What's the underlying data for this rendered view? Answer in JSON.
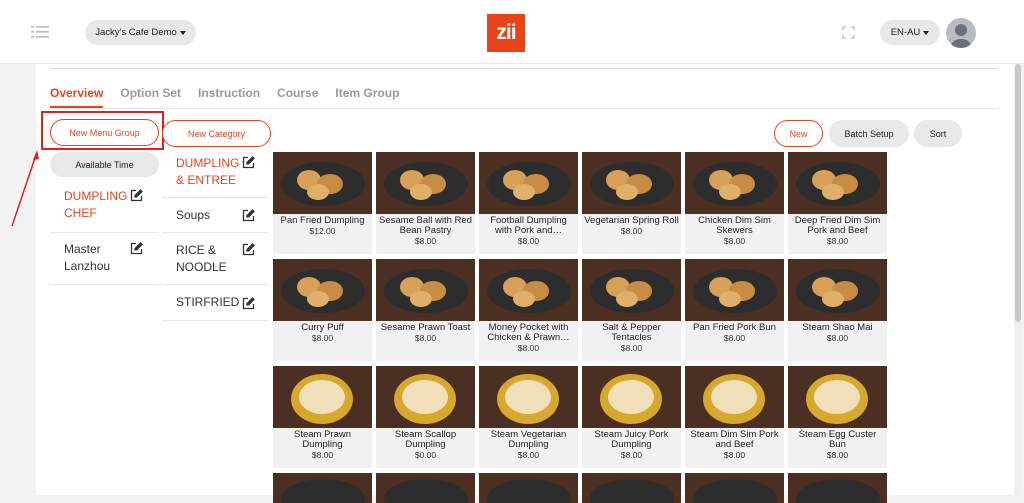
{
  "header": {
    "shop_name": "Jacky's Cafe Demo",
    "logo_text": "zii",
    "language": "EN-AU",
    "brand_color": "#e8441c"
  },
  "tabs": [
    {
      "label": "Overview",
      "active": true
    },
    {
      "label": "Option Set"
    },
    {
      "label": "Instruction"
    },
    {
      "label": "Course"
    },
    {
      "label": "Item Group"
    }
  ],
  "buttons": {
    "new_menu_group": "New Menu Group",
    "new_category": "New Category",
    "available_time": "Available Time",
    "new": "New",
    "batch_setup": "Batch Setup",
    "sort": "Sort"
  },
  "menu_groups": [
    {
      "label": "DUMPLING CHEF",
      "active": true
    },
    {
      "label": "Master Lanzhou"
    }
  ],
  "categories": [
    {
      "label": "DUMPLING & ENTREE",
      "active": true
    },
    {
      "label": "Soups"
    },
    {
      "label": "RICE & NOODLE"
    },
    {
      "label": "STIRFRIED"
    }
  ],
  "items": [
    {
      "name": "Pan Fried Dumpling",
      "price": "$12.00"
    },
    {
      "name": "Sesame Ball with Red Bean Pastry",
      "price": "$8.00"
    },
    {
      "name": "Football Dumpling with Pork and…",
      "price": "$8.00"
    },
    {
      "name": "Vegetarian Spring Roll",
      "price": "$8.00"
    },
    {
      "name": "Chicken Dim Sim Skewers",
      "price": "$8.00"
    },
    {
      "name": "Deep Fried Dim Sim Pork and Beef",
      "price": "$8.00"
    },
    {
      "name": "Curry Puff",
      "price": "$8.00"
    },
    {
      "name": "Sesame Prawn Toast",
      "price": "$8.00"
    },
    {
      "name": "Money Pocket with Chicken & Prawn…",
      "price": "$8.00"
    },
    {
      "name": "Salt & Pepper Tentacles",
      "price": "$8.00"
    },
    {
      "name": "Pan Fried Pork Bun",
      "price": "$8.00"
    },
    {
      "name": "Steam Shao Mai",
      "price": "$8.00"
    },
    {
      "name": "Steam Prawn Dumpling",
      "price": "$8.00"
    },
    {
      "name": "Steam Scallop Dumpling",
      "price": "$0.00"
    },
    {
      "name": "Steam Vegetarian Dumpling",
      "price": "$8.00"
    },
    {
      "name": "Steam Juicy Pork Dumpling",
      "price": "$8.00"
    },
    {
      "name": "Steam Dim Sim Pork and Beef",
      "price": "$8.00"
    },
    {
      "name": "Steam Egg Custer Bun",
      "price": "$8.00"
    }
  ]
}
